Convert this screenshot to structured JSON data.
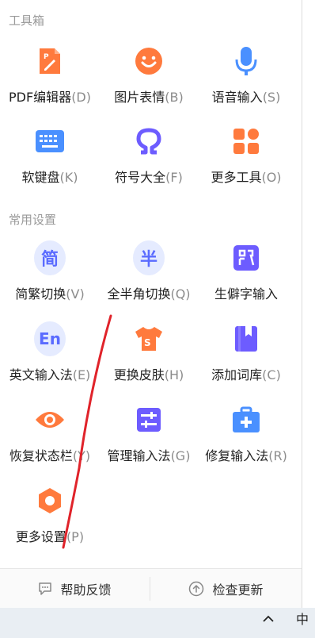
{
  "sections": {
    "toolbox": "工具箱",
    "common_settings": "常用设置"
  },
  "toolbox_items": [
    {
      "name": "PDF编辑器",
      "key": "(D)"
    },
    {
      "name": "图片表情",
      "key": "(B)"
    },
    {
      "name": "语音输入",
      "key": "(S)"
    },
    {
      "name": "软键盘",
      "key": "(K)"
    },
    {
      "name": "符号大全",
      "key": "(F)"
    },
    {
      "name": "更多工具",
      "key": "(O)"
    }
  ],
  "settings_items": [
    {
      "name": "简繁切换",
      "key": "(V)",
      "glyph": "简"
    },
    {
      "name": "全半角切换",
      "key": "(Q)",
      "glyph": "半"
    },
    {
      "name": "生僻字输入",
      "key": ""
    },
    {
      "name": "英文输入法",
      "key": "(E)",
      "glyph": "En"
    },
    {
      "name": "更换皮肤",
      "key": "(H)"
    },
    {
      "name": "添加词库",
      "key": "(C)"
    },
    {
      "name": "恢复状态栏",
      "key": "(Y)"
    },
    {
      "name": "管理输入法",
      "key": "(G)"
    },
    {
      "name": "修复输入法",
      "key": "(R)"
    },
    {
      "name": "更多设置",
      "key": "(P)"
    }
  ],
  "bottom": {
    "help": "帮助反馈",
    "update": "检查更新"
  },
  "taskbar": {
    "ime_indicator": "中"
  },
  "colors": {
    "orange": "#ff7a3d",
    "blue": "#4a90ff",
    "purple": "#6d5cff",
    "annotation": "#e0232a"
  }
}
